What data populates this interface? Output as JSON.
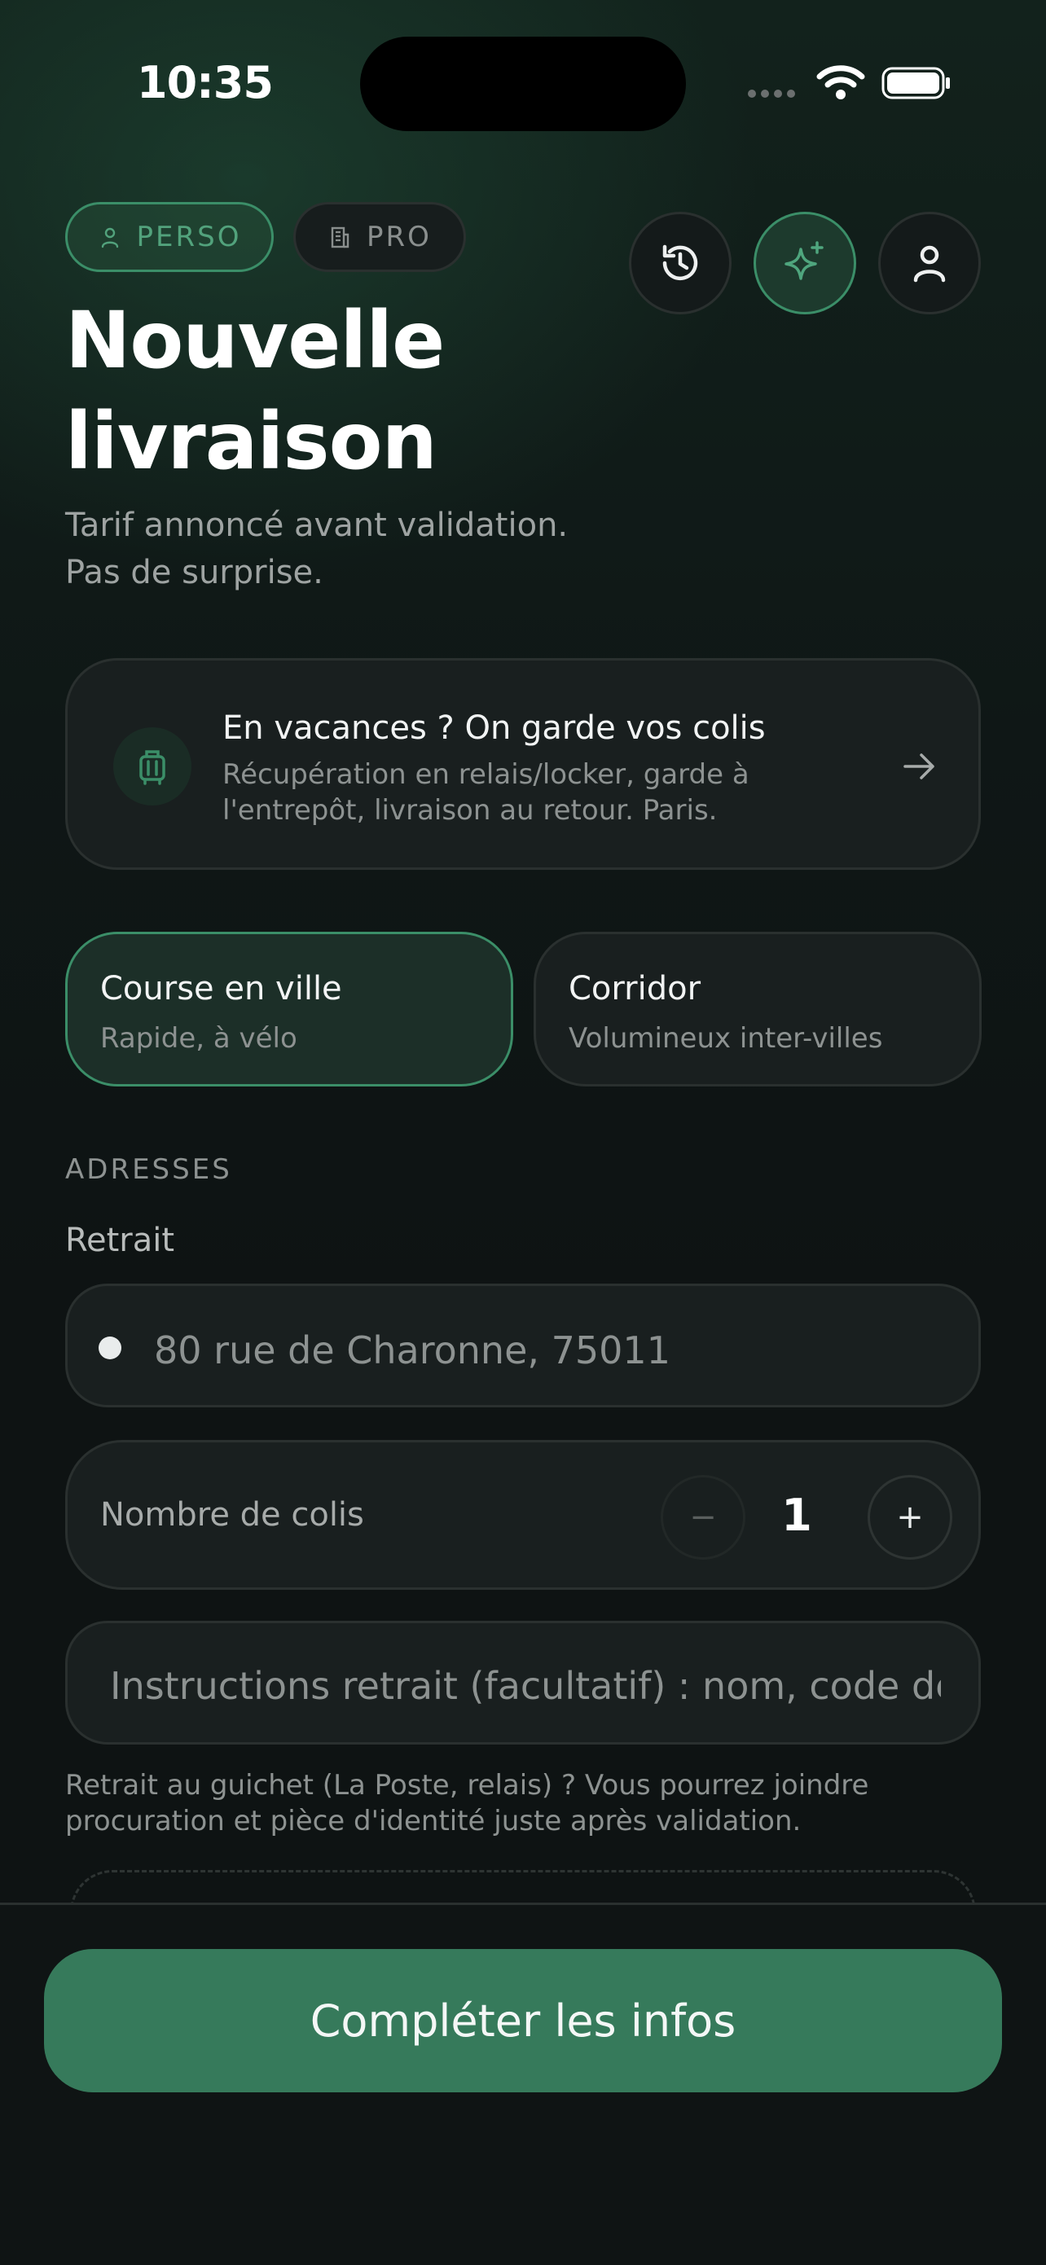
{
  "status_bar": {
    "time": "10:35"
  },
  "profile_tabs": [
    {
      "label": "PERSO",
      "icon": "user-icon",
      "active": true
    },
    {
      "label": "PRO",
      "icon": "building-icon",
      "active": false
    }
  ],
  "header_actions": [
    {
      "name": "history-icon"
    },
    {
      "name": "sparkle-icon",
      "accent": "#3b8e68"
    },
    {
      "name": "user-icon"
    }
  ],
  "page": {
    "title_line1": "Nouvelle",
    "title_line2": "livraison",
    "subtitle_line1": "Tarif annoncé avant validation.",
    "subtitle_line2": "Pas de surprise."
  },
  "vacation_card": {
    "title": "En vacances ? On garde vos colis",
    "desc_line1": "Récupération en relais/locker, garde à",
    "desc_line2": "l'entrepôt, livraison au retour. Paris.",
    "icon": "luggage-icon"
  },
  "modes": [
    {
      "title": "Course en ville",
      "subtitle": "Rapide, à vélo",
      "selected": true
    },
    {
      "title": "Corridor",
      "subtitle": "Volumineux inter-villes",
      "selected": false
    }
  ],
  "addresses": {
    "section_label": "ADRESSES",
    "pickup_label": "Retrait",
    "pickup_value": "80 rue de Charonne, 75011"
  },
  "parcels": {
    "label": "Nombre de colis",
    "count": "1",
    "minus": "−",
    "plus": "+"
  },
  "instructions": {
    "placeholder": "Instructions retrait (facultatif) : nom, code de re"
  },
  "help": {
    "line1": "Retrait au guichet (La Poste, relais) ? Vous pourrez joindre",
    "line2": "procuration et pièce d'identité juste après validation."
  },
  "cta": {
    "label": "Compléter les infos"
  },
  "colors": {
    "accent": "#3b8e68",
    "cta": "#367a5b",
    "background": "#0e1313"
  }
}
